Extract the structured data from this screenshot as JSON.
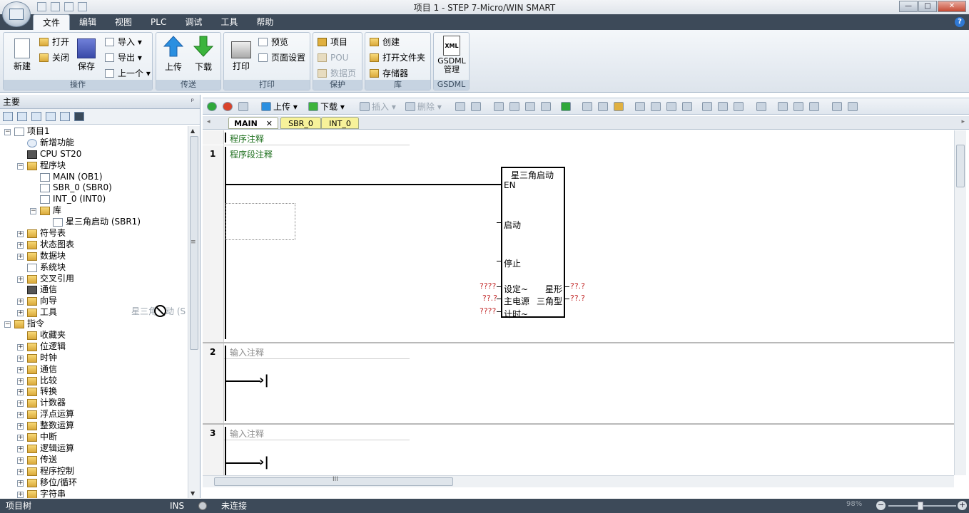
{
  "window": {
    "title": "项目 1 - STEP 7-Micro/WIN SMART",
    "controls": {
      "minimize": "—",
      "maximize": "□",
      "close": "✕"
    }
  },
  "menu": {
    "items": [
      "文件",
      "编辑",
      "视图",
      "PLC",
      "调试",
      "工具",
      "帮助"
    ],
    "active": "文件",
    "help": "?"
  },
  "ribbon": {
    "groups": {
      "operate": {
        "title": "操作",
        "new": "新建",
        "open": "打开",
        "close": "关闭",
        "save": "保存",
        "import": "导入 ▾",
        "export": "导出 ▾",
        "previous": "上一个 ▾"
      },
      "transfer": {
        "title": "传送",
        "upload": "上传",
        "download": "下载"
      },
      "print": {
        "title": "打印",
        "print": "打印",
        "preview": "预览",
        "page_setup": "页面设置"
      },
      "protect": {
        "title": "保护",
        "project": "项目",
        "pou": "POU",
        "data_page": "数据页"
      },
      "library": {
        "title": "库",
        "create": "创建",
        "open_folder": "打开文件夹",
        "memory": "存储器"
      },
      "gsdml": {
        "title": "GSDML",
        "manage": "GSDML管理",
        "xml": "XML"
      }
    }
  },
  "left_pane": {
    "title": "主要",
    "pin": "ᵖ",
    "tree": [
      {
        "label": "项目1",
        "level": 0,
        "exp": "−",
        "icon": "project-icon"
      },
      {
        "label": "新增功能",
        "level": 1,
        "exp": "",
        "icon": "help-icon"
      },
      {
        "label": "CPU ST20",
        "level": 1,
        "exp": "",
        "icon": "cpu-icon"
      },
      {
        "label": "程序块",
        "level": 1,
        "exp": "−",
        "icon": "folder-icon"
      },
      {
        "label": "MAIN (OB1)",
        "level": 2,
        "exp": "",
        "icon": "page-icon"
      },
      {
        "label": "SBR_0 (SBR0)",
        "level": 2,
        "exp": "",
        "icon": "page-icon"
      },
      {
        "label": "INT_0 (INT0)",
        "level": 2,
        "exp": "",
        "icon": "page-icon"
      },
      {
        "label": "库",
        "level": 2,
        "exp": "−",
        "icon": "library-icon"
      },
      {
        "label": "星三角启动 (SBR1)",
        "level": 3,
        "exp": "",
        "icon": "page-icon"
      },
      {
        "label": "符号表",
        "level": 1,
        "exp": "+",
        "icon": "folder-icon"
      },
      {
        "label": "状态图表",
        "level": 1,
        "exp": "+",
        "icon": "folder-icon"
      },
      {
        "label": "数据块",
        "level": 1,
        "exp": "+",
        "icon": "folder-icon"
      },
      {
        "label": "系统块",
        "level": 1,
        "exp": "",
        "icon": "page-icon"
      },
      {
        "label": "交叉引用",
        "level": 1,
        "exp": "+",
        "icon": "folder-icon"
      },
      {
        "label": "通信",
        "level": 1,
        "exp": "",
        "icon": "comm-icon"
      },
      {
        "label": "向导",
        "level": 1,
        "exp": "+",
        "icon": "wizard-icon"
      },
      {
        "label": "工具",
        "level": 1,
        "exp": "+",
        "icon": "folder-icon"
      },
      {
        "label": "指令",
        "level": 0,
        "exp": "−",
        "icon": "folder-icon"
      },
      {
        "label": "收藏夹",
        "level": 1,
        "exp": "",
        "icon": "folder-icon"
      },
      {
        "label": "位逻辑",
        "level": 1,
        "exp": "+",
        "icon": "folder-icon"
      },
      {
        "label": "时钟",
        "level": 1,
        "exp": "+",
        "icon": "folder-icon"
      },
      {
        "label": "通信",
        "level": 1,
        "exp": "+",
        "icon": "folder-icon"
      },
      {
        "label": "比较",
        "level": 1,
        "exp": "+",
        "icon": "folder-icon"
      },
      {
        "label": "转换",
        "level": 1,
        "exp": "+",
        "icon": "folder-icon"
      },
      {
        "label": "计数器",
        "level": 1,
        "exp": "+",
        "icon": "folder-icon"
      },
      {
        "label": "浮点运算",
        "level": 1,
        "exp": "+",
        "icon": "folder-icon"
      },
      {
        "label": "整数运算",
        "level": 1,
        "exp": "+",
        "icon": "folder-icon"
      },
      {
        "label": "中断",
        "level": 1,
        "exp": "+",
        "icon": "folder-icon"
      },
      {
        "label": "逻辑运算",
        "level": 1,
        "exp": "+",
        "icon": "folder-icon"
      },
      {
        "label": "传送",
        "level": 1,
        "exp": "+",
        "icon": "folder-icon"
      },
      {
        "label": "程序控制",
        "level": 1,
        "exp": "+",
        "icon": "folder-icon"
      },
      {
        "label": "移位/循环",
        "level": 1,
        "exp": "+",
        "icon": "folder-icon"
      },
      {
        "label": "字符串",
        "level": 1,
        "exp": "+",
        "icon": "folder-icon"
      }
    ],
    "drag_ghost": "星三角启动 (S",
    "scroll_grip": "≡"
  },
  "editor": {
    "toolbar": {
      "upload": "上传 ▾",
      "download": "下载 ▾",
      "insert": "插入 ▾",
      "delete": "删除 ▾"
    },
    "tabs": [
      {
        "label": "MAIN",
        "close": "✕"
      },
      {
        "label": "SBR_0"
      },
      {
        "label": "INT_0"
      }
    ],
    "program_comment": "程序注释",
    "networks": [
      {
        "number": "1",
        "comment": "程序段注释"
      },
      {
        "number": "2",
        "comment": "输入注释"
      },
      {
        "number": "3",
        "comment": "输入注释"
      }
    ],
    "block": {
      "title": "星三角启动",
      "pins_left": [
        "EN",
        "启动",
        "停止",
        "设定~",
        "主电源",
        "计时~"
      ],
      "pins_right": [
        "星形",
        "三角型"
      ],
      "operands_left": [
        "????",
        "??.?",
        "????"
      ],
      "operands_right": [
        "??.?",
        "??.?"
      ]
    },
    "hscroll_grip": "III"
  },
  "status": {
    "tree_label": "项目树",
    "ins": "INS",
    "connection": "未连接",
    "zoom": "98%",
    "zoom_minus": "−",
    "zoom_plus": "+"
  }
}
